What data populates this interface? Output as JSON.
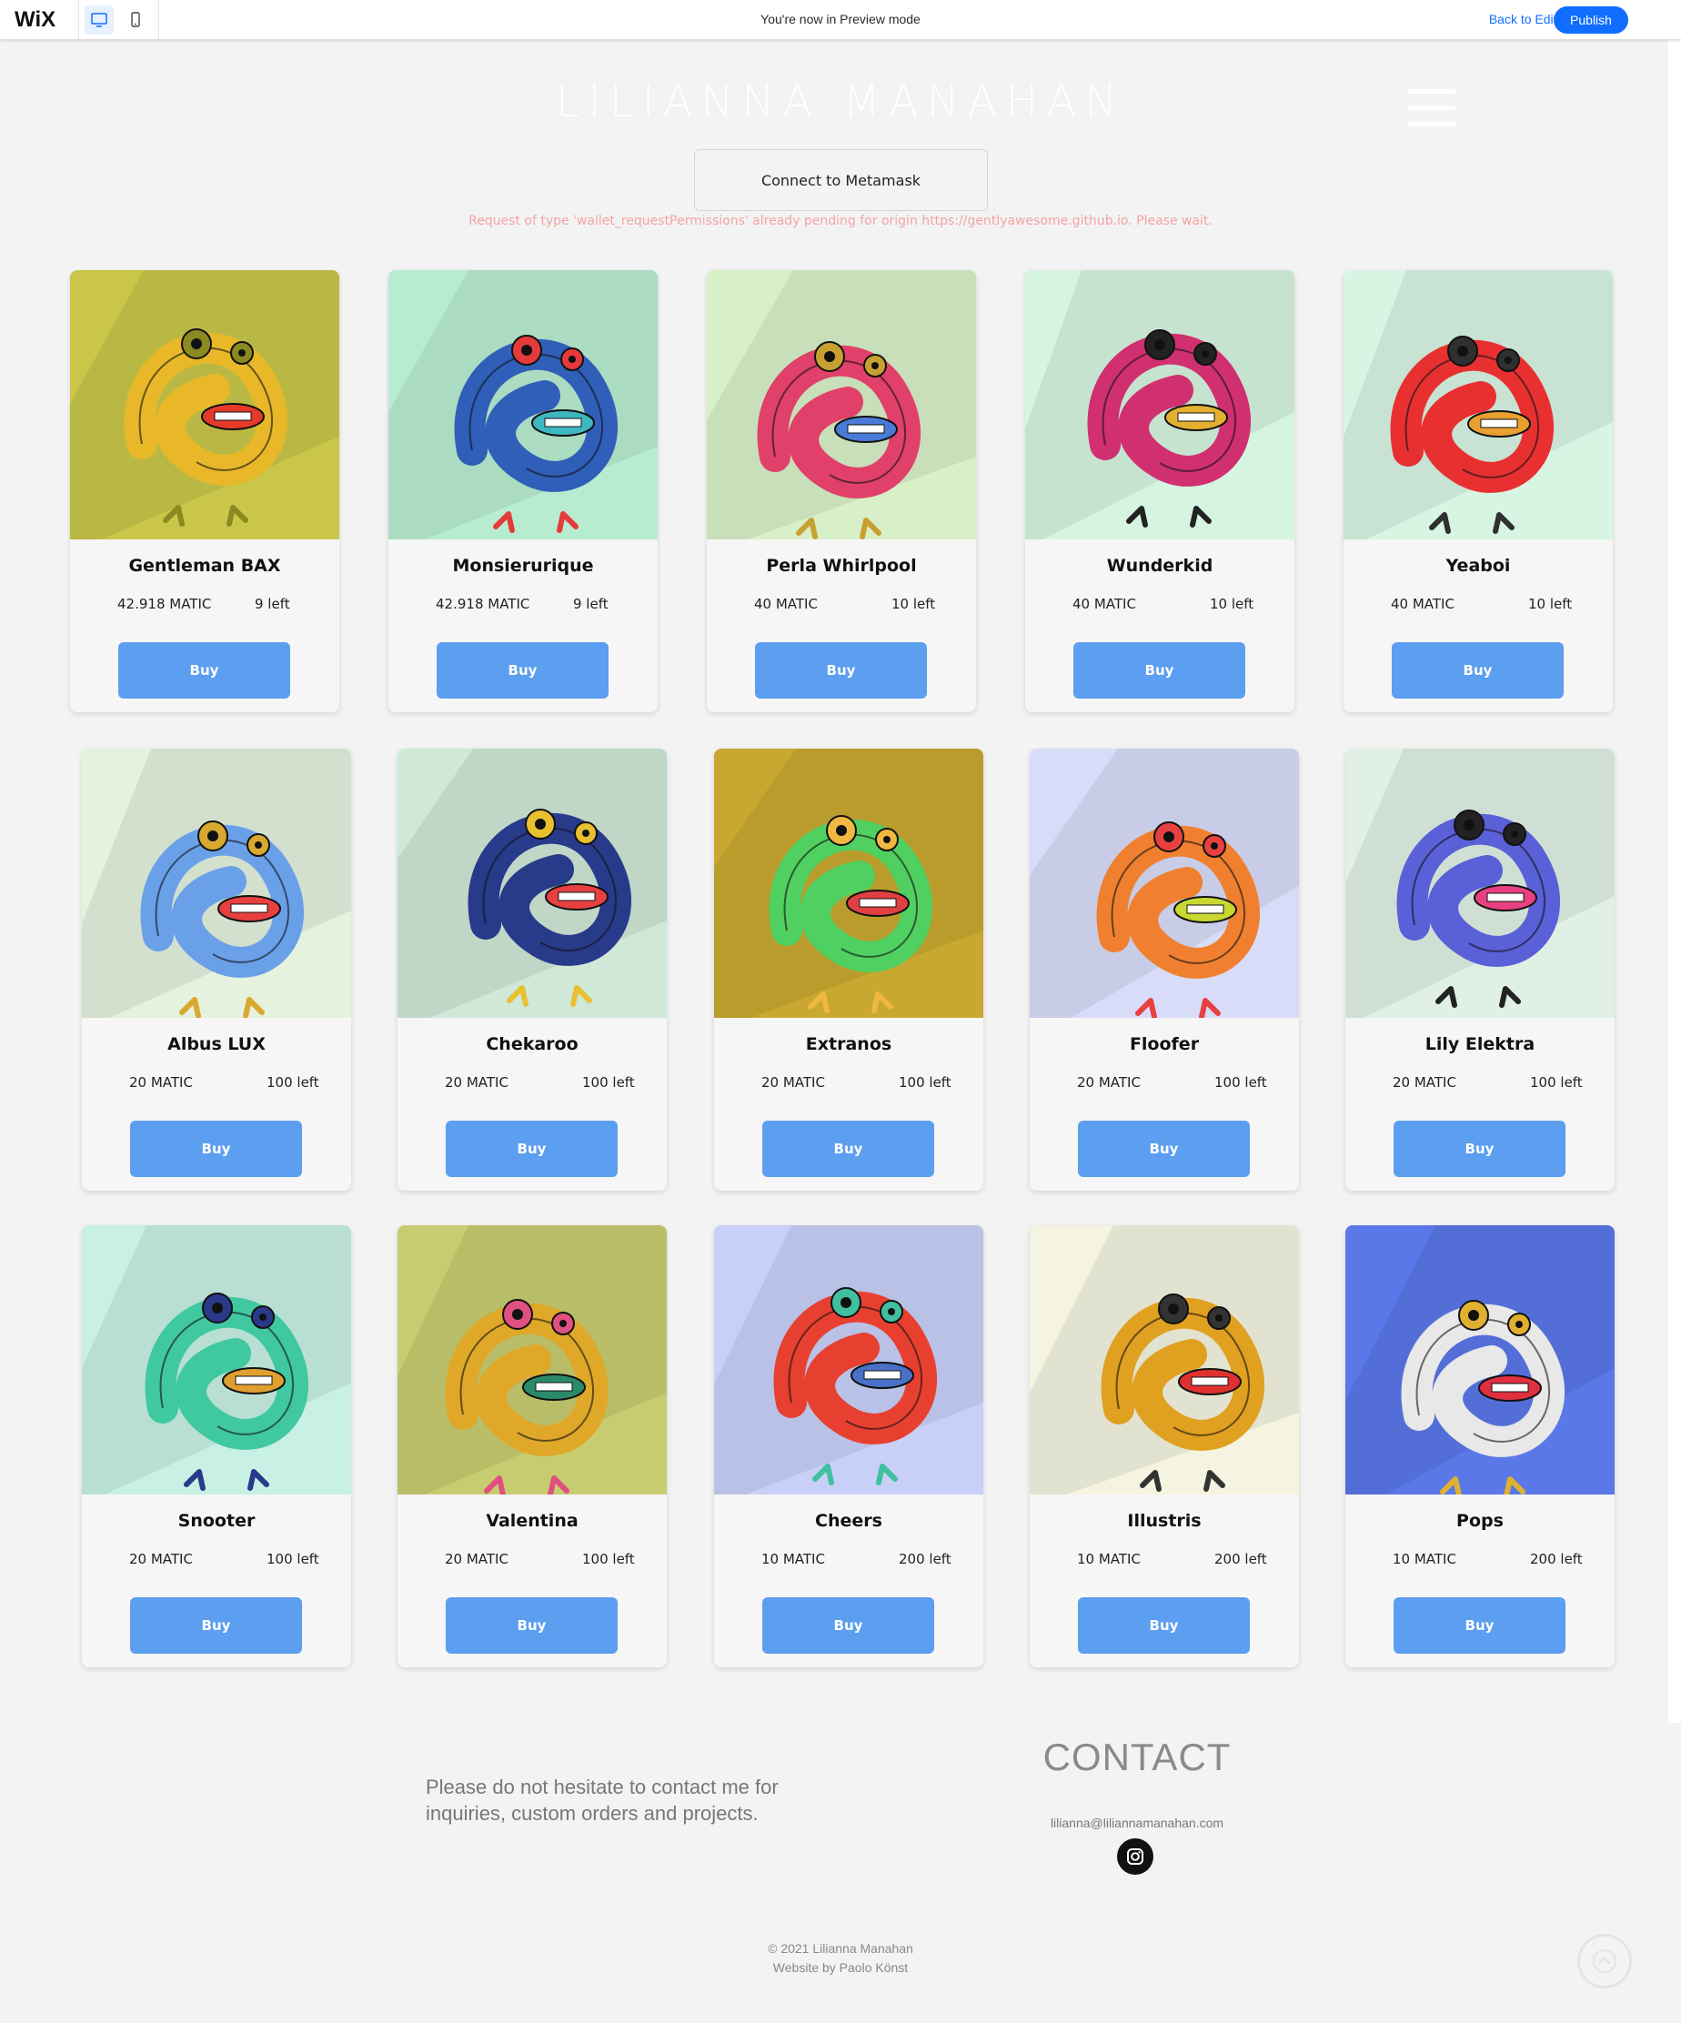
{
  "wix_bar": {
    "logo": "WiX",
    "preview_text": "You're now in Preview mode",
    "back_label": "Back to Editor",
    "publish_label": "Publish",
    "icons": [
      "desktop-icon",
      "mobile-icon"
    ]
  },
  "site": {
    "title": "LILIANNA MANAHAN",
    "connect_label": "Connect to Metamask",
    "error": "Request of type 'wallet_requestPermissions' already pending for origin https://gentlyawesome.github.io. Please wait."
  },
  "buy_label": "Buy",
  "nfts": [
    {
      "name": "Gentleman BAX",
      "price": "42.918 MATIC",
      "left": "9 left",
      "palette": [
        "#c9c64a",
        "#e8b828",
        "#e53a2a",
        "#8a8a20"
      ]
    },
    {
      "name": "Monsierurique",
      "price": "42.918 MATIC",
      "left": "9 left",
      "palette": [
        "#b8ecd0",
        "#2f5fb8",
        "#3fb7c0",
        "#e43a3a"
      ]
    },
    {
      "name": "Perla Whirlpool",
      "price": "40 MATIC",
      "left": "10 left",
      "palette": [
        "#d8f0c8",
        "#e0406a",
        "#4a7ad8",
        "#c8a030"
      ]
    },
    {
      "name": "Wunderkid",
      "price": "40 MATIC",
      "left": "10 left",
      "palette": [
        "#d6f5e0",
        "#d03070",
        "#e4b030",
        "#222222"
      ]
    },
    {
      "name": "Yeaboi",
      "price": "40 MATIC",
      "left": "10 left",
      "palette": [
        "#d8f5e4",
        "#e83030",
        "#e8a030",
        "#303030"
      ]
    },
    {
      "name": "Albus LUX",
      "price": "20 MATIC",
      "left": "100 left",
      "palette": [
        "#e4f2de",
        "#6aa0e8",
        "#e84040",
        "#d8a830"
      ]
    },
    {
      "name": "Chekaroo",
      "price": "20 MATIC",
      "left": "100 left",
      "palette": [
        "#cfe8d8",
        "#283a8a",
        "#e84040",
        "#e8c030"
      ]
    },
    {
      "name": "Extranos",
      "price": "20 MATIC",
      "left": "100 left",
      "palette": [
        "#c8a830",
        "#50d060",
        "#e04040",
        "#f0b840"
      ]
    },
    {
      "name": "Floofer",
      "price": "20 MATIC",
      "left": "100 left",
      "palette": [
        "#d8dcf8",
        "#f08030",
        "#c8d830",
        "#e84040"
      ]
    },
    {
      "name": "Lily Elektra",
      "price": "20 MATIC",
      "left": "100 left",
      "palette": [
        "#e0f0e4",
        "#5a60d8",
        "#e84080",
        "#222222"
      ]
    },
    {
      "name": "Snooter",
      "price": "20 MATIC",
      "left": "100 left",
      "palette": [
        "#c8f0e4",
        "#40c8a0",
        "#e0a030",
        "#2a3a8a"
      ]
    },
    {
      "name": "Valentina",
      "price": "20 MATIC",
      "left": "100 left",
      "palette": [
        "#c8cc70",
        "#e0a828",
        "#2a8a6a",
        "#e05080"
      ]
    },
    {
      "name": "Cheers",
      "price": "10 MATIC",
      "left": "200 left",
      "palette": [
        "#c8d0f8",
        "#e84030",
        "#4a70c8",
        "#40c0a0"
      ]
    },
    {
      "name": "Illustris",
      "price": "10 MATIC",
      "left": "200 left",
      "palette": [
        "#f4f4e0",
        "#e0a020",
        "#e03030",
        "#333333"
      ]
    },
    {
      "name": "Pops",
      "price": "10 MATIC",
      "left": "200 left",
      "palette": [
        "#5a78e8",
        "#e8e8e8",
        "#e03040",
        "#e0b030"
      ]
    }
  ],
  "contact": {
    "text": "Please do not hesitate to contact me for inquiries, custom orders and projects.",
    "heading": "CONTACT",
    "email": "lilianna@liliannamanahan.com"
  },
  "footer": {
    "copyright": "© 2021 Lilianna Manahan",
    "credit": "Website by Paolo Könst"
  }
}
